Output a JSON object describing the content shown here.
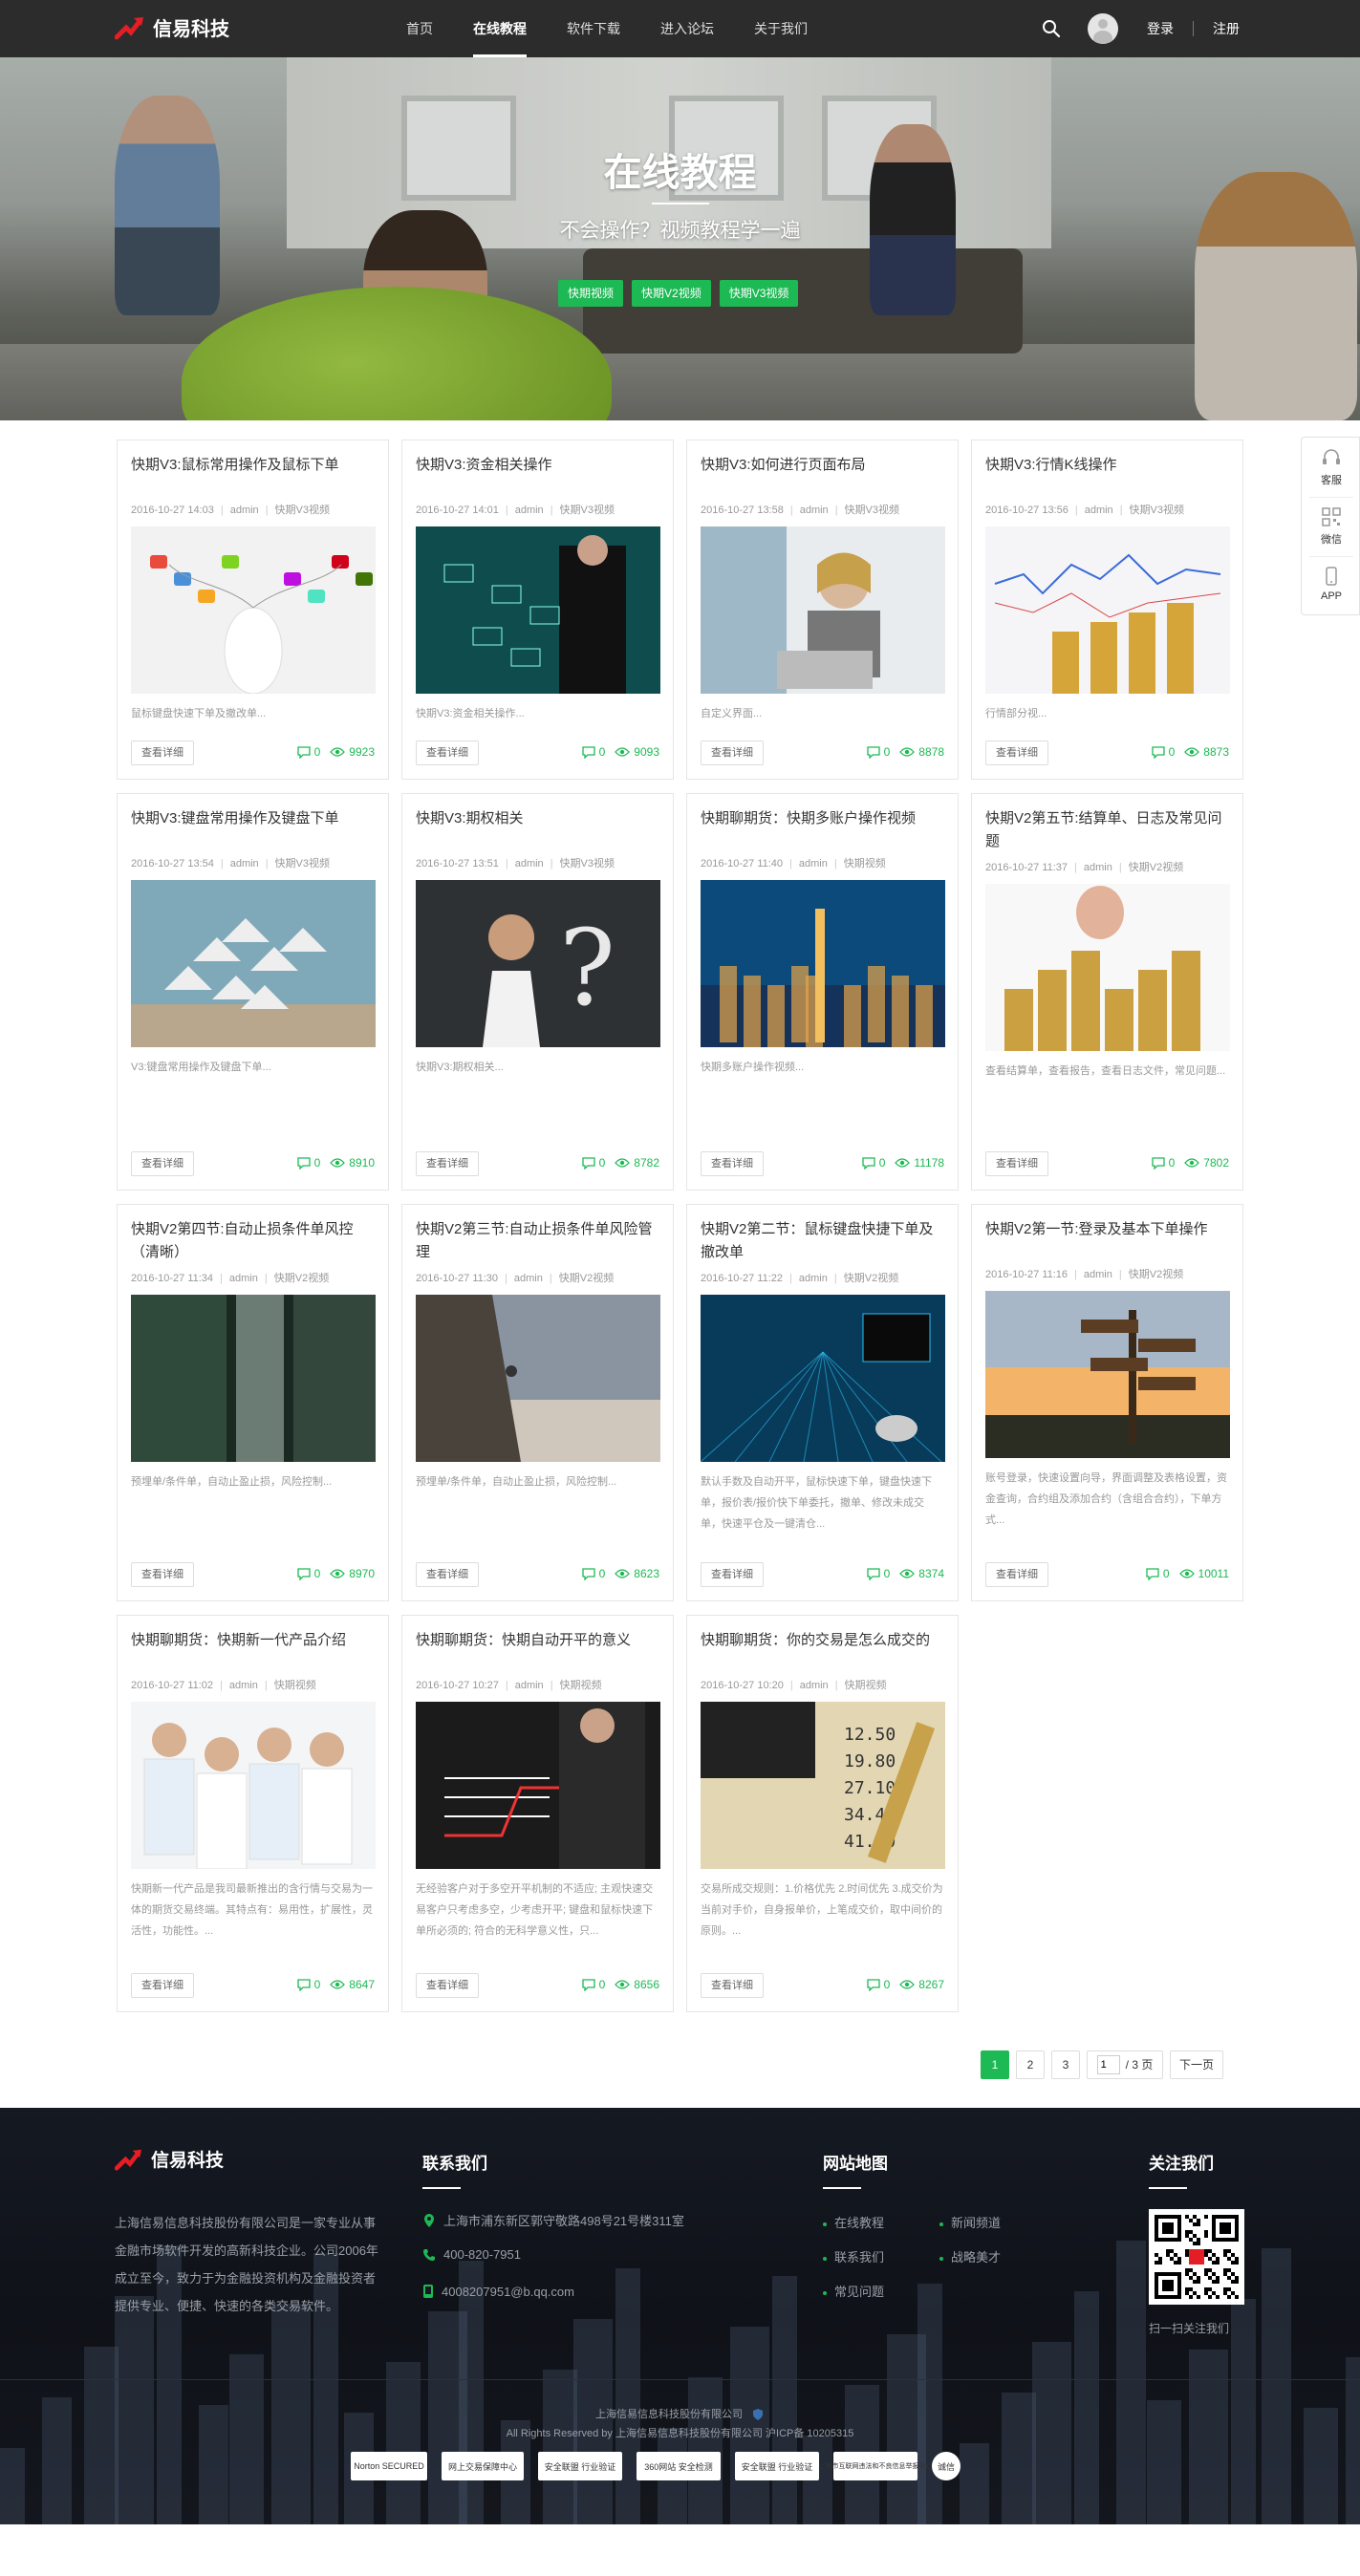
{
  "brand": {
    "name": "信易科技",
    "accent": "#1db954"
  },
  "nav": {
    "links": [
      "首页",
      "在线教程",
      "软件下载",
      "进入论坛",
      "关于我们"
    ],
    "active_index": 1,
    "login": "登录",
    "register": "注册"
  },
  "hero": {
    "title": "在线教程",
    "subtitle": "不会操作？视频教程学一遍",
    "tags": [
      "快期视频",
      "快期V2视频",
      "快期V3视频"
    ]
  },
  "sidebar": {
    "items": [
      "客服",
      "微信",
      "APP"
    ]
  },
  "card_button": "查看详细",
  "cards": [
    {
      "title": "快期V3:鼠标常用操作及鼠标下单",
      "date": "2016-10-27 14:03",
      "author": "admin",
      "category": "快期V3视频",
      "desc": "鼠标键盘快速下单及撤改单...",
      "comments": "0",
      "views": "9923",
      "img": "mouse"
    },
    {
      "title": "快期V3:资金相关操作",
      "date": "2016-10-27 14:01",
      "author": "admin",
      "category": "快期V3视频",
      "desc": "快期V3:资金相关操作...",
      "comments": "0",
      "views": "9093",
      "img": "teal"
    },
    {
      "title": "快期V3:如何进行页面布局",
      "date": "2016-10-27 13:58",
      "author": "admin",
      "category": "快期V3视频",
      "desc": "自定义界面...",
      "comments": "0",
      "views": "8878",
      "img": "laptop"
    },
    {
      "title": "快期V3:行情K线操作",
      "date": "2016-10-27 13:56",
      "author": "admin",
      "category": "快期V3视频",
      "desc": "行情部分视...",
      "comments": "0",
      "views": "8873",
      "img": "coins"
    },
    {
      "title": "快期V3:键盘常用操作及键盘下单",
      "date": "2016-10-27 13:54",
      "author": "admin",
      "category": "快期V3视频",
      "desc": "V3:键盘常用操作及键盘下单...",
      "comments": "0",
      "views": "8910",
      "img": "triangles"
    },
    {
      "title": "快期V3:期权相关",
      "date": "2016-10-27 13:51",
      "author": "admin",
      "category": "快期V3视频",
      "desc": "快期V3:期权相关...",
      "comments": "0",
      "views": "8782",
      "img": "question"
    },
    {
      "title": "快期聊期货：快期多账户操作视频",
      "date": "2016-10-27 11:40",
      "author": "admin",
      "category": "快期视频",
      "desc": "快期多账户操作视频...",
      "comments": "0",
      "views": "11178",
      "img": "city"
    },
    {
      "title": "快期V2第五节:结算单、日志及常见问题",
      "date": "2016-10-27 11:37",
      "author": "admin",
      "category": "快期V2视频",
      "desc": "查看结算单，查看报告，查看日志文件，常见问题...",
      "comments": "0",
      "views": "7802",
      "img": "coinstack"
    },
    {
      "title": "快期V2第四节:自动止损条件单风控（清晰）",
      "date": "2016-10-27 11:34",
      "author": "admin",
      "category": "快期V2视频",
      "desc": "预埋单/条件单，自动止盈止损，风险控制...",
      "comments": "0",
      "views": "8970",
      "img": "buildings"
    },
    {
      "title": "快期V2第三节:自动止损条件单风险管理",
      "date": "2016-10-27 11:30",
      "author": "admin",
      "category": "快期V2视频",
      "desc": "预埋单/条件单，自动止盈止损，风险控制...",
      "comments": "0",
      "views": "8623",
      "img": "climber"
    },
    {
      "title": "快期V2第二节：鼠标键盘快捷下单及撤改单",
      "date": "2016-10-27 11:22",
      "author": "admin",
      "category": "快期V2视频",
      "desc": "默认手数及自动开平，鼠标快速下单，键盘快速下单，报价表/报价快下单委托，撤单、修改未成交单，快速平仓及一键清仓...",
      "comments": "0",
      "views": "8374",
      "img": "tech"
    },
    {
      "title": "快期V2第一节:登录及基本下单操作",
      "date": "2016-10-27 11:16",
      "author": "admin",
      "category": "快期V2视频",
      "desc": "账号登录，快速设置向导，界面调整及表格设置，资金查询，合约组及添加合约（含组合合约），下单方式...",
      "comments": "0",
      "views": "10011",
      "img": "signpost"
    },
    {
      "title": "快期聊期货：快期新一代产品介绍",
      "date": "2016-10-27 11:02",
      "author": "admin",
      "category": "快期视频",
      "desc": "快期新一代产品是我司最新推出的含行情与交易为一体的期货交易终端。其特点有：易用性，扩展性，灵活性，功能性。...",
      "comments": "0",
      "views": "8647",
      "img": "team"
    },
    {
      "title": "快期聊期货：快期自动开平的意义",
      "date": "2016-10-27 10:27",
      "author": "admin",
      "category": "快期视频",
      "desc": "无经验客户对于多空开平机制的不适应; 主观快速交易客户只考虑多空，少考虑开平; 键盘和鼠标快速下单所必须的; 符合的无科学意义性，只...",
      "comments": "0",
      "views": "8656",
      "img": "business"
    },
    {
      "title": "快期聊期货：你的交易是怎么成交的",
      "date": "2016-10-27 10:20",
      "author": "admin",
      "category": "快期视频",
      "desc": "交易所成交规则：1.价格优先 2.时间优先 3.成交价为当前对手价，自身报单价，上笔成交价，取中间价的原则。...",
      "comments": "0",
      "views": "8267",
      "img": "calculator"
    }
  ],
  "pagination": {
    "pages": [
      "1",
      "2",
      "3"
    ],
    "active": "1",
    "input_value": "1",
    "total": "/ 3 页",
    "next": "下一页"
  },
  "footer": {
    "brand": "信易科技",
    "about": "上海信易信息科技股份有限公司是一家专业从事金融市场软件开发的高新科技企业。公司2006年成立至今，致力于为金融投资机构及金融投资者提供专业、便捷、快速的各类交易软件。",
    "contact_title": "联系我们",
    "address": "上海市浦东新区郭守敬路498号21号楼311室",
    "phone": "400-820-7951",
    "email": "4008207951@b.qq.com",
    "sitemap_title": "网站地图",
    "sitemap_links": [
      "在线教程",
      "新闻频道",
      "联系我们",
      "战略美才",
      "常见问题"
    ],
    "follow_title": "关注我们",
    "qr_caption": "扫一扫关注我们",
    "copyright": "上海信易信息科技股份有限公司",
    "rights": "All Rights Reserved by 上海信易信息科技股份有限公司 沪ICP备 10205315",
    "badges": [
      "Norton SECURED",
      "网上交易保障中心",
      "安全联盟 行业验证",
      "360网站 安全检测",
      "安全联盟 行业验证",
      "上海市互联网违法和不良信息举报中心",
      "诚信"
    ]
  }
}
